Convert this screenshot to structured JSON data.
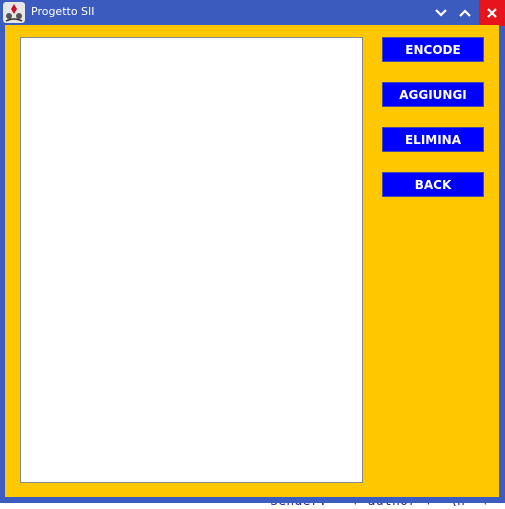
{
  "window": {
    "title": "Progetto SII",
    "controls": {
      "minimize_icon": "chevron-down-icon",
      "maximize_icon": "chevron-up-icon",
      "close_icon": "close-icon"
    }
  },
  "main": {
    "list_items": [],
    "buttons": {
      "encode": "ENCODE",
      "aggiungi": "AGGIUNGI",
      "elimina": "ELIMINA",
      "back": "BACK"
    }
  },
  "background": {
    "code_snippet": "\"Sender: \" + author + \"\\n\" +"
  },
  "colors": {
    "titlebar": "#3c5bbe",
    "content_bg": "#ffc700",
    "button_bg": "#0000ff",
    "close_bg": "#e8141b"
  }
}
